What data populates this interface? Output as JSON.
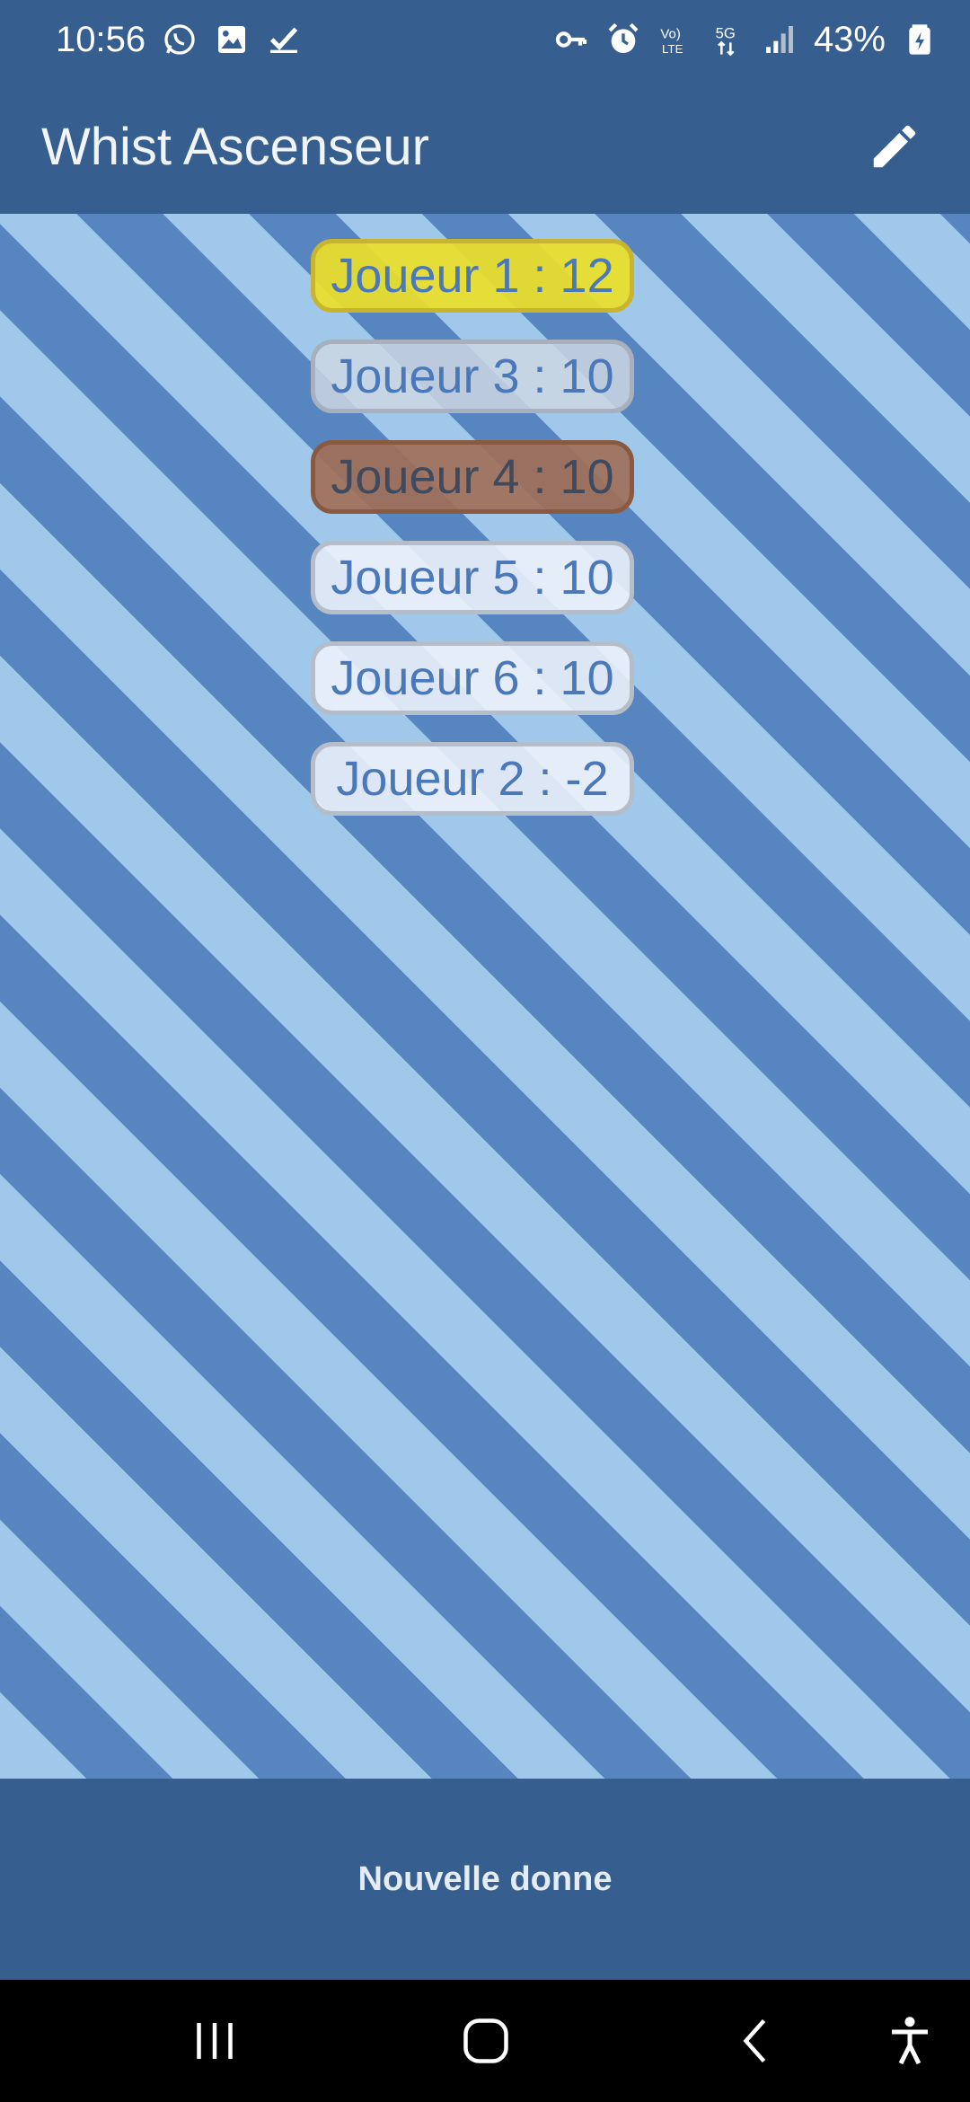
{
  "status_bar": {
    "time": "10:56",
    "battery": "43%",
    "icons": [
      "whatsapp-icon",
      "image-icon",
      "check-icon",
      "key-icon",
      "alarm-icon",
      "volte-icon",
      "5g-icon",
      "signal-icon",
      "battery-icon"
    ]
  },
  "app_bar": {
    "title": "Whist Ascenseur",
    "edit_icon": "pencil-icon"
  },
  "players": [
    {
      "label": "Joueur 1 : 12",
      "rank_style": "gold"
    },
    {
      "label": "Joueur 3 : 10",
      "rank_style": "silver"
    },
    {
      "label": "Joueur 4 : 10",
      "rank_style": "bronze"
    },
    {
      "label": "Joueur 5 : 10",
      "rank_style": "white"
    },
    {
      "label": "Joueur 6 : 10",
      "rank_style": "white"
    },
    {
      "label": "Joueur 2 : -2",
      "rank_style": "white"
    }
  ],
  "bottom_bar": {
    "new_deal_label": "Nouvelle donne"
  },
  "colors": {
    "primary": "#365f8f",
    "stripe_light": "#9fc8ea",
    "stripe_dark": "#5685bf",
    "gold": "#ece028",
    "bronze": "#a07058"
  },
  "nav_bar": {
    "icons": [
      "recent-apps-icon",
      "home-icon",
      "back-icon",
      "accessibility-icon"
    ]
  }
}
